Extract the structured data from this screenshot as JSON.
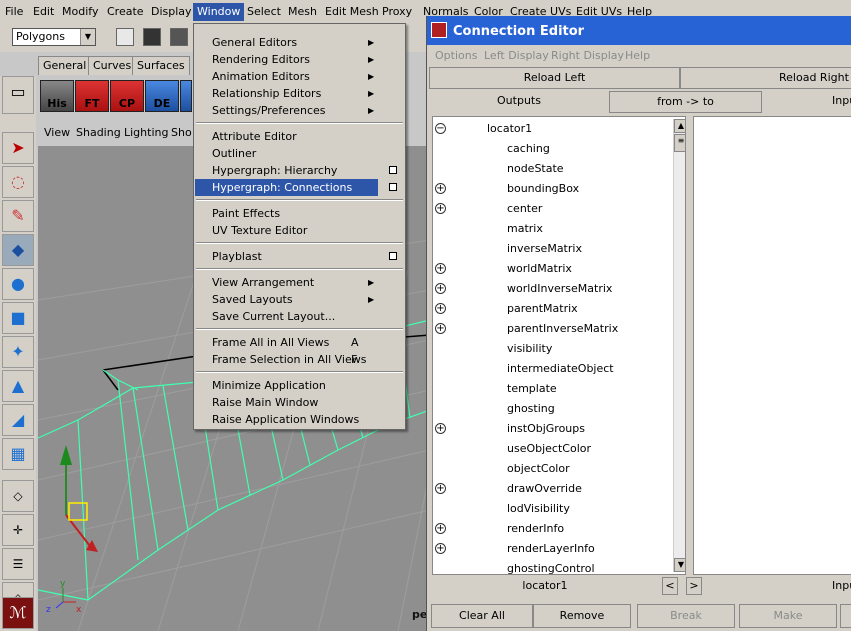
{
  "menubar": {
    "items": [
      "File",
      "Edit",
      "Modify",
      "Create",
      "Display",
      "Window",
      "Select",
      "Mesh",
      "Edit Mesh",
      "Proxy",
      "Normals",
      "Color",
      "Create UVs",
      "Edit UVs",
      "Help"
    ],
    "active": "Window"
  },
  "toolbar": {
    "mode_value": "Polygons"
  },
  "shelf": {
    "tabs": [
      "General",
      "Curves",
      "Surfaces"
    ],
    "buttons": [
      "His",
      "FT",
      "CP",
      "DE"
    ]
  },
  "viewport": {
    "menus": [
      "View",
      "Shading",
      "Lighting",
      "Sho"
    ],
    "corner_label": "pe"
  },
  "window_menu": {
    "items": [
      {
        "label": "General Editors",
        "submenu": true
      },
      {
        "label": "Rendering Editors",
        "submenu": true
      },
      {
        "label": "Animation Editors",
        "submenu": true
      },
      {
        "label": "Relationship Editors",
        "submenu": true
      },
      {
        "label": "Settings/Preferences",
        "submenu": true
      },
      {
        "label": "Attribute Editor"
      },
      {
        "label": "Outliner"
      },
      {
        "label": "Hypergraph: Hierarchy",
        "option": true
      },
      {
        "label": "Hypergraph: Connections",
        "option": true,
        "highlighted": true
      },
      {
        "label": "Paint Effects"
      },
      {
        "label": "UV Texture Editor"
      },
      {
        "label": "Playblast",
        "option": true
      },
      {
        "label": "View Arrangement",
        "submenu": true
      },
      {
        "label": "Saved Layouts",
        "submenu": true
      },
      {
        "label": "Save Current Layout..."
      },
      {
        "label": "Frame All in All Views",
        "accel": "A"
      },
      {
        "label": "Frame Selection in All Views",
        "accel": "F"
      },
      {
        "label": "Minimize Application"
      },
      {
        "label": "Raise Main Window"
      },
      {
        "label": "Raise Application Windows"
      }
    ]
  },
  "connection_editor": {
    "title": "Connection Editor",
    "menus": [
      "Options",
      "Left Display",
      "Right Display",
      "Help"
    ],
    "reload_left": "Reload Left",
    "reload_right": "Reload Right",
    "outputs_label": "Outputs",
    "direction_label": "from -> to",
    "inputs_label": "Inpu",
    "node_name": "locator1",
    "attributes": [
      {
        "name": "caching",
        "expand": false
      },
      {
        "name": "nodeState",
        "expand": false
      },
      {
        "name": "boundingBox",
        "expand": true
      },
      {
        "name": "center",
        "expand": true
      },
      {
        "name": "matrix",
        "expand": false
      },
      {
        "name": "inverseMatrix",
        "expand": false
      },
      {
        "name": "worldMatrix",
        "expand": true
      },
      {
        "name": "worldInverseMatrix",
        "expand": true
      },
      {
        "name": "parentMatrix",
        "expand": true
      },
      {
        "name": "parentInverseMatrix",
        "expand": true
      },
      {
        "name": "visibility",
        "expand": false
      },
      {
        "name": "intermediateObject",
        "expand": false
      },
      {
        "name": "template",
        "expand": false
      },
      {
        "name": "ghosting",
        "expand": false
      },
      {
        "name": "instObjGroups",
        "expand": true
      },
      {
        "name": "useObjectColor",
        "expand": false
      },
      {
        "name": "objectColor",
        "expand": false
      },
      {
        "name": "drawOverride",
        "expand": true
      },
      {
        "name": "lodVisibility",
        "expand": false
      },
      {
        "name": "renderInfo",
        "expand": true
      },
      {
        "name": "renderLayerInfo",
        "expand": true
      },
      {
        "name": "ghostingControl",
        "expand": false
      }
    ],
    "bottom_left_node": "locator1",
    "bottom_right_label": "Inpu",
    "buttons": {
      "clear_all": "Clear All",
      "remove": "Remove",
      "break": "Break",
      "make": "Make"
    }
  },
  "colors": {
    "title_bar": "#2863d6",
    "highlight": "#2d56a8",
    "wireframe": "#40ffb0"
  }
}
